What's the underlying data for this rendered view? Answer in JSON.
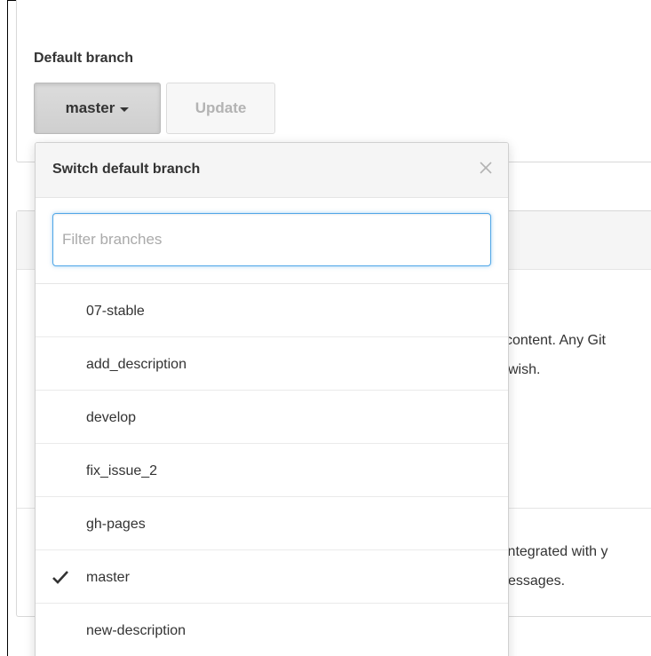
{
  "settings": {
    "section_label": "Default branch",
    "current_branch_button": "master",
    "update_button": "Update"
  },
  "background": {
    "partial_line_1": "content. Any Git",
    "partial_line_2": "wish.",
    "partial_line_3": "integrated with y",
    "partial_line_4": "essages."
  },
  "dropdown": {
    "title": "Switch default branch",
    "close_icon": "close-icon",
    "filter_placeholder": "Filter branches",
    "filter_value": "",
    "selected_branch": "master",
    "branches": [
      "07-stable",
      "add_description",
      "develop",
      "fix_issue_2",
      "gh-pages",
      "master",
      "new-description"
    ]
  },
  "colors": {
    "focus_border": "#51a7e8",
    "header_bg": "#f5f5f5",
    "selected_button_bg": "#d4d4d4"
  }
}
